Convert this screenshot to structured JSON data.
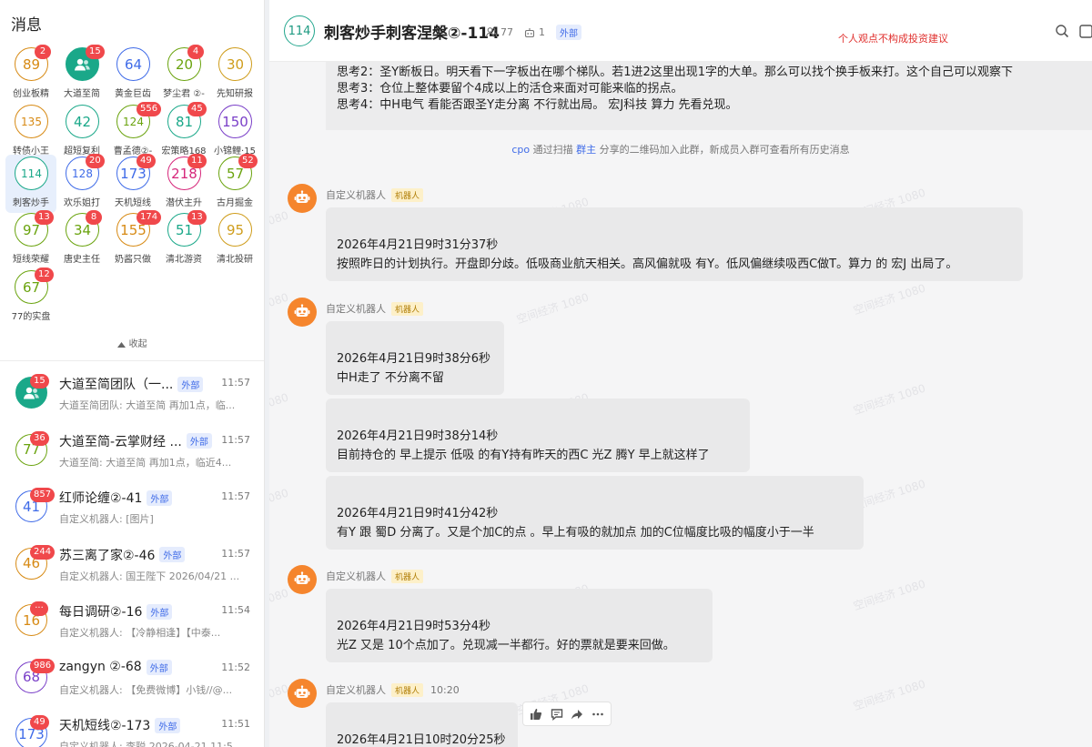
{
  "sidebar": {
    "title": "消息",
    "collapse_label": "收起",
    "groups": [
      {
        "text": "89",
        "label": "创业板精",
        "badge": "2",
        "color": "#d78a14",
        "icon": false,
        "selected": false,
        "sm": false
      },
      {
        "text": "",
        "label": "大道至简",
        "badge": "15",
        "color": "#1aa889",
        "icon": true,
        "selected": false,
        "sm": false
      },
      {
        "text": "64",
        "label": "黄金巨齿",
        "badge": "",
        "color": "#3f6be8",
        "icon": false,
        "selected": false,
        "sm": false
      },
      {
        "text": "20",
        "label": "梦尘君 ②-",
        "badge": "4",
        "color": "#6aa30e",
        "icon": false,
        "selected": false,
        "sm": false
      },
      {
        "text": "30",
        "label": "先知研报",
        "badge": "",
        "color": "#cf9d1c",
        "icon": false,
        "selected": false,
        "sm": false
      },
      {
        "text": "135",
        "label": "转债小王",
        "badge": "",
        "color": "#d78a14",
        "icon": false,
        "selected": false,
        "sm": true
      },
      {
        "text": "42",
        "label": "超短复利",
        "badge": "",
        "color": "#1aa889",
        "icon": false,
        "selected": false,
        "sm": false
      },
      {
        "text": "124",
        "label": "曹孟德②-",
        "badge": "556",
        "color": "#6aa30e",
        "icon": false,
        "selected": false,
        "sm": true
      },
      {
        "text": "81",
        "label": "宏策略168",
        "badge": "45",
        "color": "#1aa889",
        "icon": false,
        "selected": false,
        "sm": false
      },
      {
        "text": "150",
        "label": "小锦鲤·15",
        "badge": "",
        "color": "#7a3fc8",
        "icon": false,
        "selected": false,
        "sm": false
      },
      {
        "text": "114",
        "label": "刺客炒手",
        "badge": "",
        "color": "#1aa889",
        "icon": false,
        "selected": true,
        "sm": true
      },
      {
        "text": "128",
        "label": "欢乐姐打",
        "badge": "20",
        "color": "#3f6be8",
        "icon": false,
        "selected": false,
        "sm": true
      },
      {
        "text": "173",
        "label": "天机短线",
        "badge": "49",
        "color": "#3f6be8",
        "icon": false,
        "selected": false,
        "sm": false
      },
      {
        "text": "218",
        "label": "潜伏主升",
        "badge": "11",
        "color": "#d6267a",
        "icon": false,
        "selected": false,
        "sm": false
      },
      {
        "text": "57",
        "label": "古月掘金",
        "badge": "52",
        "color": "#6aa30e",
        "icon": false,
        "selected": false,
        "sm": false
      },
      {
        "text": "97",
        "label": "短线荣耀",
        "badge": "13",
        "color": "#6aa30e",
        "icon": false,
        "selected": false,
        "sm": false
      },
      {
        "text": "34",
        "label": "唐史主任",
        "badge": "8",
        "color": "#6aa30e",
        "icon": false,
        "selected": false,
        "sm": false
      },
      {
        "text": "155",
        "label": "奶酱只做",
        "badge": "174",
        "color": "#d78a14",
        "icon": false,
        "selected": false,
        "sm": false
      },
      {
        "text": "51",
        "label": "清北游资",
        "badge": "13",
        "color": "#1aa889",
        "icon": false,
        "selected": false,
        "sm": false
      },
      {
        "text": "95",
        "label": "清北投研",
        "badge": "",
        "color": "#cf9d1c",
        "icon": false,
        "selected": false,
        "sm": false
      },
      {
        "text": "67",
        "label": "77的实盘",
        "badge": "12",
        "color": "#6aa30e",
        "icon": false,
        "selected": false,
        "sm": false
      }
    ],
    "chats": [
      {
        "av": "",
        "icon": true,
        "color": "#1aa889",
        "badge": "15",
        "title": "大道至简团队（一...",
        "ext": "外部",
        "time": "11:57",
        "preview": "大道至简团队: 大道至简 再加1点，临..."
      },
      {
        "av": "77",
        "icon": false,
        "color": "#6aa30e",
        "badge": "36",
        "title": "大道至简-云掌财经 ...",
        "ext": "外部",
        "time": "11:57",
        "preview": "大道至简: 大道至简 再加1点，临近4..."
      },
      {
        "av": "41",
        "icon": false,
        "color": "#3f6be8",
        "badge": "857",
        "title": "红师论缠②-41",
        "ext": "外部",
        "time": "11:57",
        "preview": "自定义机器人: [图片]"
      },
      {
        "av": "46",
        "icon": false,
        "color": "#d78a14",
        "badge": "244",
        "title": "苏三离了家②-46",
        "ext": "外部",
        "time": "11:57",
        "preview": "自定义机器人: 国王陛下 2026/04/21 ..."
      },
      {
        "av": "16",
        "icon": false,
        "color": "#d78a14",
        "badge": "···",
        "title": "每日调研②-16",
        "ext": "外部",
        "time": "11:54",
        "preview": "自定义机器人: 【冷静相逢】【中泰..."
      },
      {
        "av": "68",
        "icon": false,
        "color": "#7a3fc8",
        "badge": "986",
        "title": "zangyn ②-68",
        "ext": "外部",
        "time": "11:52",
        "preview": "自定义机器人: 【免费微博】小钱//@..."
      },
      {
        "av": "173",
        "icon": false,
        "color": "#3f6be8",
        "badge": "49",
        "title": "天机短线②-173",
        "ext": "外部",
        "time": "11:51",
        "preview": "自定义机器人: 李聪 2026-04-21 11:5..."
      }
    ]
  },
  "header": {
    "avatar": "114",
    "title": "刺客炒手刺客涅槃②-114",
    "members": "77",
    "bots": "1",
    "ext": "外部",
    "disclaimer": "个人观点不构成投资建议"
  },
  "quote": {
    "lines": [
      "思考2：圣Y断板日。明天看下一字板出在哪个梯队。若1进2这里出现1字的大单。那么可以找个换手板来打。这个自己可以观察下",
      "思考3：仓位上整体要留个4成以上的活仓来面对可能来临的拐点。",
      "思考4：中H电气 看能否跟圣Y走分离 不行就出局。 宏J科技 算力 先看兑现。"
    ]
  },
  "system_msg": {
    "user": "cpo",
    "t1": "通过扫描",
    "owner": "群主",
    "t2": "分享的二维码加入此群，新成员入群可查看所有历史消息"
  },
  "sender_name": "自定义机器人",
  "robot_tag": "机器人",
  "messages": [
    {
      "show_sender": true,
      "time": "",
      "lines": [
        "2026年4月21日9时31分37秒",
        "按照昨日的计划执行。开盘即分歧。低吸商业航天相关。高风偏就吸 有Y。低风偏继续吸西C做T。算力 的 宏J 出局了。"
      ]
    },
    {
      "show_sender": true,
      "time": "",
      "lines": [
        "2026年4月21日9时38分6秒",
        "中H走了 不分离不留"
      ]
    },
    {
      "show_sender": false,
      "time": "",
      "lines": [
        "2026年4月21日9时38分14秒",
        "目前持仓的 早上提示 低吸 的有Y持有昨天的西C 光Z 腾Y 早上就这样了"
      ]
    },
    {
      "show_sender": false,
      "time": "",
      "lines": [
        "2026年4月21日9时41分42秒",
        "有Y 跟 蜀D 分离了。又是个加C的点 。早上有吸的就加点 加的C位幅度比吸的幅度小于一半"
      ]
    },
    {
      "show_sender": true,
      "time": "",
      "lines": [
        "2026年4月21日9时53分4秒",
        "光Z 又是 10个点加了。兑现减一半都行。好的票就是要来回做。"
      ]
    },
    {
      "show_sender": true,
      "time": "10:20",
      "lines": [
        "2026年4月21日10时20分25秒"
      ]
    }
  ],
  "watermark": "空间经济 1080"
}
